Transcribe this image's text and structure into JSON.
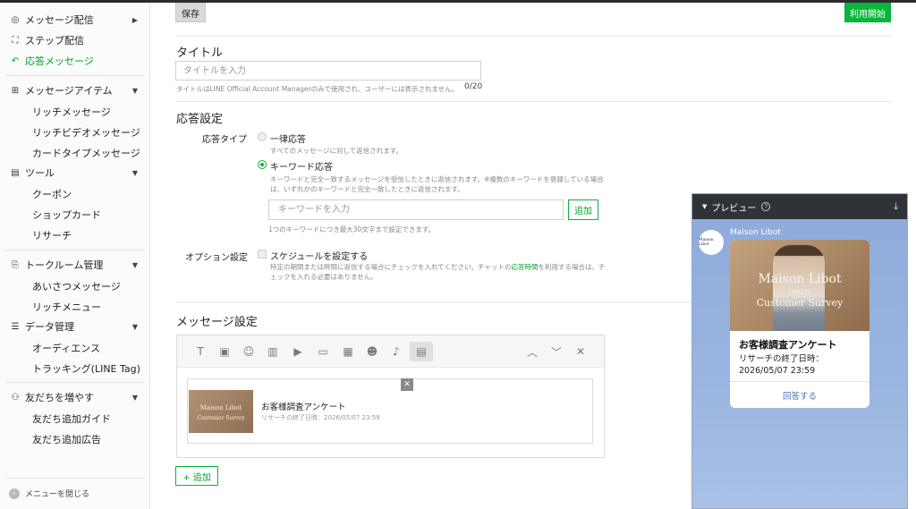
{
  "sidebar": {
    "items": [
      {
        "label": "メッセージ配信",
        "icon": "broadcast-icon",
        "has_arrow": true
      },
      {
        "label": "ステップ配信",
        "icon": "step-icon"
      },
      {
        "label": "応答メッセージ",
        "icon": "reply-icon",
        "active": true
      },
      {
        "label": "メッセージアイテム",
        "icon": "message-item-icon",
        "expanded": true
      },
      {
        "label": "リッチメッセージ"
      },
      {
        "label": "リッチビデオメッセージ"
      },
      {
        "label": "カードタイプメッセージ"
      },
      {
        "label": "ツール",
        "icon": "tool-icon",
        "expanded": true
      },
      {
        "label": "クーポン"
      },
      {
        "label": "ショップカード"
      },
      {
        "label": "リサーチ"
      },
      {
        "label": "トークルーム管理",
        "icon": "talkroom-icon",
        "expanded": true
      },
      {
        "label": "あいさつメッセージ"
      },
      {
        "label": "リッチメニュー"
      },
      {
        "label": "データ管理",
        "icon": "database-icon",
        "expanded": true
      },
      {
        "label": "オーディエンス"
      },
      {
        "label": "トラッキング(LINE Tag)"
      },
      {
        "label": "友だちを増やす",
        "icon": "add-friend-icon",
        "expanded": true
      },
      {
        "label": "友だち追加ガイド"
      },
      {
        "label": "友だち追加広告"
      }
    ],
    "close_menu": "メニューを閉じる"
  },
  "toolbar": {
    "save_label": "保存",
    "start_label": "利用開始"
  },
  "title_section": {
    "heading": "タイトル",
    "placeholder": "タイトルを入力",
    "note": "タイトルはLINE Official Account Managerのみで使用され、ユーザーには表示されません。",
    "counter": "0/20"
  },
  "response": {
    "heading": "応答設定",
    "type_label": "応答タイプ",
    "options": [
      {
        "label": "一律応答",
        "desc": "すべてのメッセージに対して返信されます。",
        "selected": false
      },
      {
        "label": "キーワード応答",
        "desc1": "キーワードと完全一致するメッセージを受信したときに返信されます。※複数のキーワードを登録している場合",
        "desc2": "は、いずれかのキーワードと完全一致したときに返信されます。",
        "selected": true
      }
    ],
    "keyword_placeholder": "キーワードを入力",
    "keyword_add": "追加",
    "keyword_note": "1つのキーワードにつき最大30文字まで設定できます。",
    "option_label": "オプション設定",
    "schedule_label": "スケジュールを設定する",
    "schedule_desc_pre": "特定の期間または時間に返信する場合にチェックを入れてください。チャットの",
    "schedule_desc_link": "応答時間",
    "schedule_desc_post": "を利用する場合は、チ",
    "schedule_desc2": "ェックを入れる必要はありません。"
  },
  "message": {
    "heading": "メッセージ設定",
    "tools": [
      "text-icon",
      "sticker-icon",
      "emoji-icon",
      "coupon-icon",
      "video-icon",
      "image-icon",
      "card-icon",
      "smile-icon",
      "mic-icon",
      "research-icon"
    ],
    "card": {
      "title": "お客様調査アンケート",
      "sub": "リサーチの終了日時：2026/05/07 23:59",
      "thumb_line1": "Maison Libot",
      "thumb_line2": "Customer Survey"
    },
    "add_label": "+ 追加"
  },
  "preview": {
    "header": "プレビュー",
    "account_name": "Maison Libot",
    "avatar_text": "Maison Libot",
    "image_line1": "Maison Libot",
    "image_line2": "JAPAN",
    "image_line3": "Customer Survey",
    "card_title": "お客様調査アンケート",
    "card_sub_line1": "リサーチの終了日時：",
    "card_sub_line2": "2026/05/07 23:59",
    "answer_label": "回答する"
  },
  "colors": {
    "accent": "#06b53a",
    "preview_header": "#2f3237",
    "preview_bg": "#9ab5e0",
    "link_blue": "#4a72b8"
  }
}
